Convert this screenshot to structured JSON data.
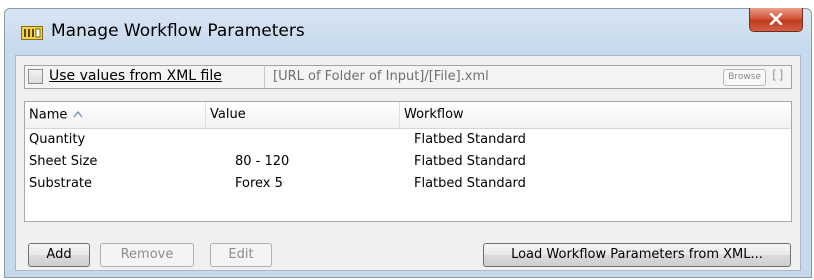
{
  "window": {
    "title": "Manage Workflow Parameters"
  },
  "xml_source": {
    "checkbox_label": "Use values from XML file",
    "checked": false,
    "path_value": "[URL of Folder of Input]/[File].xml",
    "browse_label": "Browse",
    "bracket_label": "[]"
  },
  "table": {
    "columns": [
      "Name",
      "Value",
      "Workflow"
    ],
    "sort_column": "Name",
    "sort_direction": "ascending",
    "rows": [
      {
        "name": "Quantity",
        "value": "",
        "workflow": "Flatbed Standard"
      },
      {
        "name": "Sheet Size",
        "value": "80 - 120",
        "workflow": "Flatbed Standard"
      },
      {
        "name": "Substrate",
        "value": "Forex 5",
        "workflow": "Flatbed Standard"
      }
    ]
  },
  "buttons": {
    "add": "Add",
    "remove": "Remove",
    "edit": "Edit",
    "load_xml": "Load Workflow Parameters from XML..."
  },
  "colors": {
    "title_bar": "#c7d9ec",
    "close_button": "#c9432a",
    "panel_background": "#f0f0f0"
  },
  "icons": {
    "title": "parameters-window-icon",
    "close": "close-icon",
    "sort": "sort-ascending-icon"
  }
}
